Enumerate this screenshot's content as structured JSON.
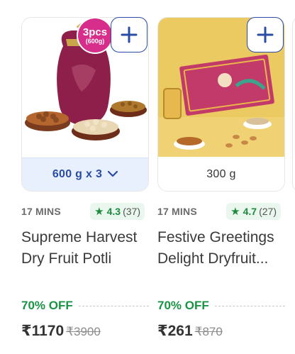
{
  "colors": {
    "accent_blue": "#2a4ba6",
    "offer_green": "#1a9345",
    "rating_bg": "#e9f7ee",
    "badge_pink": "#d62e8a"
  },
  "products": [
    {
      "badge_big": "3pcs",
      "badge_small": "(600g)",
      "variant": "600 g x 3",
      "eta": "17 MINS",
      "rating": "4.3",
      "rating_count": "(37)",
      "title": "Supreme Harvest Dry Fruit Potli",
      "offer": "70% OFF",
      "price": "₹1170",
      "mrp": "₹3900"
    },
    {
      "variant": "300 g",
      "eta": "17 MINS",
      "rating": "4.7",
      "rating_count": "(27)",
      "title": "Festive Greetings Delight Dryfruit...",
      "offer": "70% OFF",
      "price": "₹261",
      "mrp": "₹870"
    }
  ],
  "icons": {
    "add": "plus-icon",
    "star": "star-icon",
    "variant_dropdown": "chevron-down-icon",
    "veg": "veg-indicator-icon"
  }
}
